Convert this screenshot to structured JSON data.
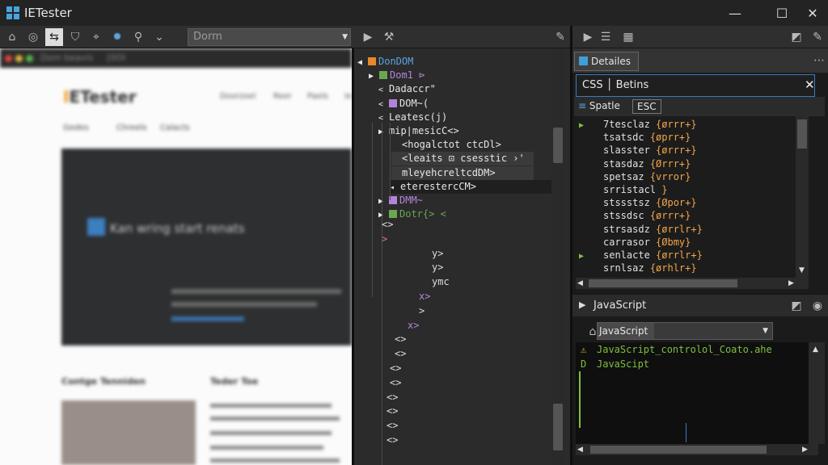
{
  "window": {
    "title": "IETester",
    "minimize": "—",
    "maximize": "☐",
    "close": "✕"
  },
  "toolbar": {
    "address_value": "Dorm"
  },
  "browser": {
    "top_text": "Dom beavis",
    "top_tag": "[0OI",
    "logo_prefix": "I",
    "logo_rest": "ETester",
    "nav": [
      "Doorzoel",
      "Reer",
      "Paels",
      "Ie"
    ],
    "subnav": [
      "Gedes",
      "Chreels",
      "Calacts"
    ],
    "hero_text": "Kan wring start renats",
    "footer_left": "Contge Tenniden",
    "footer_right": "Teder Toe"
  },
  "dom": {
    "nodes": [
      {
        "label": "DonDOM",
        "indent": 0,
        "color": "#5aa5e0",
        "tag": "#e8882a",
        "expand": "◀"
      },
      {
        "label": "D​om1 ⊳",
        "indent": 1,
        "color": "#b383d9",
        "tag": "#6aa84f",
        "expand": "▶"
      },
      {
        "label": "Dadaccr\"",
        "indent": 2,
        "color": "#e6e6e6",
        "tag": "",
        "expand": "<"
      },
      {
        "label": "DOM~(",
        "indent": 2,
        "color": "#e6e6e6",
        "tag": "#b383d9",
        "expand": "<"
      },
      {
        "label": "Leatesc(j)",
        "indent": 2,
        "color": "#e6e6e6",
        "tag": "",
        "expand": "<"
      },
      {
        "label": "mip∣mesicC<>",
        "indent": 3,
        "color": "#e6e6e6",
        "tag": "",
        "expand": "▶"
      },
      {
        "label": "<hogalctot ctcDl>",
        "indent": 4,
        "color": "#e6e6e6",
        "tag": "",
        "expand": ""
      },
      {
        "label": "<leaits ⊡ csesstic ›'",
        "indent": 4,
        "color": "#e6e6e6",
        "tag": "",
        "expand": ""
      },
      {
        "label": "mleyehcreltcdDM>",
        "indent": 4,
        "color": "#e6e6e6",
        "tag": "",
        "expand": ""
      },
      {
        "label": "eterestercCM>",
        "indent": 3,
        "color": "#e6e6e6",
        "tag": "",
        "expand": "◂"
      },
      {
        "label": "DMM~",
        "indent": 3,
        "color": "#b383d9",
        "tag": "#b383d9",
        "expand": "▶"
      },
      {
        "label": "Dotr{> <",
        "indent": 3,
        "color": "#6aa84f",
        "tag": "#6aa84f",
        "expand": "▶"
      }
    ],
    "markers": [
      "<>",
      ">",
      "y>",
      "y>",
      "ymc",
      "x>",
      ">",
      "x>",
      "<>",
      "<>",
      "<>",
      "<>",
      "<>",
      "<>",
      "<>",
      "<>"
    ]
  },
  "right": {
    "tab_label": "Detailes",
    "css_header": "CSS │ Betins",
    "css_close": "✕",
    "css_sub_btn1": "Spatle",
    "css_sub_btn2": "ESC",
    "css_rules": [
      {
        "sel": "7tesclaz",
        "val": "{ørrr+}",
        "mark": "▶"
      },
      {
        "sel": "tsatsdc",
        "val": "{øprr+}",
        "mark": ""
      },
      {
        "sel": "sl​asster",
        "val": "{ørrr+}",
        "mark": ""
      },
      {
        "sel": "stasdaz",
        "val": "{Ørrr+}",
        "mark": ""
      },
      {
        "sel": "spetsaz",
        "val": "{vrror}",
        "mark": ""
      },
      {
        "sel": "srristacl",
        "val": "}",
        "mark": ""
      },
      {
        "sel": "stssstsz",
        "val": "{Øpor+}",
        "mark": ""
      },
      {
        "sel": "stssdsc",
        "val": "{ørrr+}",
        "mark": ""
      },
      {
        "sel": "strsasdz",
        "val": "{ørrlr+}",
        "mark": ""
      },
      {
        "sel": "carrasor",
        "val": "{Øbmy}",
        "mark": ""
      },
      {
        "sel": "senlacte",
        "val": "{ørrlr+}",
        "mark": "▶"
      },
      {
        "sel": "srnlsaz",
        "val": "{ørhlr+}",
        "mark": ""
      }
    ],
    "js_title": "JavaScript",
    "js_combo": "JavaScript",
    "js_lines": [
      "JavaScript_controlol_Coato.ahe",
      "JavaScipt"
    ]
  },
  "colors": {
    "accent": "#3a7bbf",
    "string": "#f0a54a",
    "keyword": "#6aa84f",
    "tag_purple": "#b383d9"
  }
}
